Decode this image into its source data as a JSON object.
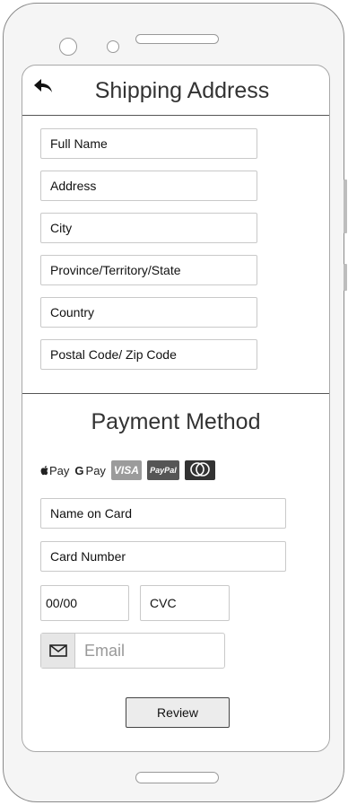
{
  "shipping": {
    "title": "Shipping Address",
    "fields": [
      {
        "label": "Full Name"
      },
      {
        "label": "Address"
      },
      {
        "label": "City"
      },
      {
        "label": "Province/Territory/State"
      },
      {
        "label": "Country"
      },
      {
        "label": "Postal Code/ Zip Code"
      }
    ]
  },
  "payment": {
    "title": "Payment Method",
    "methods": {
      "apple_pay": "Pay",
      "google_pay": "Pay",
      "visa": "VISA",
      "paypal": "PayPal",
      "mastercard_caption": "mastercard"
    },
    "name_on_card": "Name on Card",
    "card_number": "Card Number",
    "expiry": "00/00",
    "cvc": "CVC",
    "email_placeholder": "Email"
  },
  "review_label": "Review",
  "icons": {
    "back": "back-arrow-icon",
    "email": "envelope-icon"
  }
}
